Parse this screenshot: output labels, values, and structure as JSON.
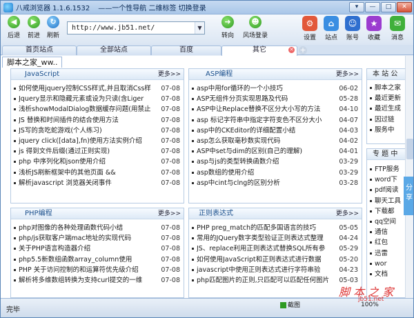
{
  "window": {
    "title": "八戒浏览器 1.1.6.1532",
    "tagline": "——一个性导航 二维标签 切换登录",
    "controls": [
      "▾",
      "—",
      "□",
      "✕"
    ]
  },
  "toolbar": {
    "back": "后退",
    "forward": "前进",
    "refresh": "刷新",
    "address": "http://www.jb51.net/",
    "goto": "转向",
    "login": "风场登录",
    "settings": "设置",
    "site": "站点",
    "account": "账号",
    "favorites": "收藏",
    "messages": "消息"
  },
  "tabs": [
    {
      "label": "首页站点"
    },
    {
      "label": "全部站点"
    },
    {
      "label": "百度"
    },
    {
      "label": "其它"
    }
  ],
  "site_tab": "脚本之家_ww..",
  "panels": {
    "js": {
      "title": "JavaScript",
      "more": "更多>>",
      "items": [
        {
          "t": "如何使用jquery控制CSS样式,并且取消Css样",
          "d": "07-08"
        },
        {
          "t": "Jquery显示和隐藏元素或设为只读(含Liger",
          "d": "07-08"
        },
        {
          "t": "浅析showModalDialog数据缓存问题(用禁止",
          "d": "07-08"
        },
        {
          "t": "JS 替换和时间插件的结合使用方法",
          "d": "07-08"
        },
        {
          "t": "JS写的贪吃蛇游戏(个人练习)",
          "d": "07-08"
        },
        {
          "t": "jquery click([data],fn)使用方法实例介绍",
          "d": "07-08"
        },
        {
          "t": "js 得到文件后缀(通过正则实现)",
          "d": "07-08"
        },
        {
          "t": "php 中序列化和json使用介绍",
          "d": "07-08"
        },
        {
          "t": "浅析JS刷新框架中的其他页面 &&",
          "d": "07-08"
        },
        {
          "t": "解析javascript 浏览器关闭事件",
          "d": "07-08"
        }
      ]
    },
    "asp": {
      "title": "ASP编程",
      "more": "更多>>",
      "items": [
        {
          "t": "asp中用for循环的一个小技巧",
          "d": "06-02"
        },
        {
          "t": "ASP无组件分页实现思路及代码",
          "d": "05-28"
        },
        {
          "t": "ASP中让Replace替换不区分大小写的方法",
          "d": "04-10"
        },
        {
          "t": "asp 标记字符串中指定字符变色不区分大小",
          "d": "04-07"
        },
        {
          "t": "asp中的CKEditor的详细配置小结",
          "d": "04-03"
        },
        {
          "t": "asp怎么获取毫秒数实现代码",
          "d": "04-02"
        },
        {
          "t": "ASP中set与dim的区别(自己的理解)",
          "d": "04-01"
        },
        {
          "t": "asp与js的类型转换函数介绍",
          "d": "03-29"
        },
        {
          "t": "asp数组的使用介绍",
          "d": "03-29"
        },
        {
          "t": "asp中cint与clng的区别分析",
          "d": "03-28"
        }
      ]
    },
    "php": {
      "title": "PHP编程",
      "more": "更多>>",
      "items": [
        {
          "t": "php对图像的各种处理函数代码小结",
          "d": "07-08"
        },
        {
          "t": "php/js获取客户端mac地址的实现代码",
          "d": "07-08"
        },
        {
          "t": "关于PHP语言构造器介绍",
          "d": "07-08"
        },
        {
          "t": "php5.5新数组函数array_column使用",
          "d": "07-08"
        },
        {
          "t": "PHP 关于访问控制的和运算符优先级介绍",
          "d": "07-08"
        },
        {
          "t": "解析将多维数组转换为支持curl提交的一维",
          "d": "07-08"
        }
      ]
    },
    "regex": {
      "title": "正则表达式",
      "more": "更多>>",
      "items": [
        {
          "t": "PHP preg_match的匹配多国语言的技巧",
          "d": "05-05"
        },
        {
          "t": "常用的JQuery数字类型验证正则表达式整理",
          "d": "04-24"
        },
        {
          "t": "JS、replace利用正则表达式替换SQL所有参",
          "d": "05-29"
        },
        {
          "t": "如何使用JavaScript和正则表达式进行数据",
          "d": "05-20"
        },
        {
          "t": "javascript中使用正则表达式进行字符串验",
          "d": "04-23"
        },
        {
          "t": "php匹配图片的正则,只匹配可以匹配任何图片",
          "d": "05-03"
        }
      ]
    },
    "rank": {
      "title": "本 站 公",
      "items": [
        "脚本之家",
        "最近更新",
        "最近生成",
        "因过链",
        "服务中"
      ]
    },
    "topic": {
      "title": "专 题 中",
      "items": [
        "FTP服务",
        "word下",
        "pdf阅读",
        "聊天工具",
        "下载都",
        "qq空间",
        "通信",
        "红包",
        "迅雷",
        "wor",
        "文档"
      ]
    }
  },
  "share": "分享",
  "status": {
    "text": "完毕",
    "capture": "截图",
    "pct": "100%"
  },
  "watermark": {
    "main": "脚 本 之 家",
    "sub": "jb51.net"
  }
}
